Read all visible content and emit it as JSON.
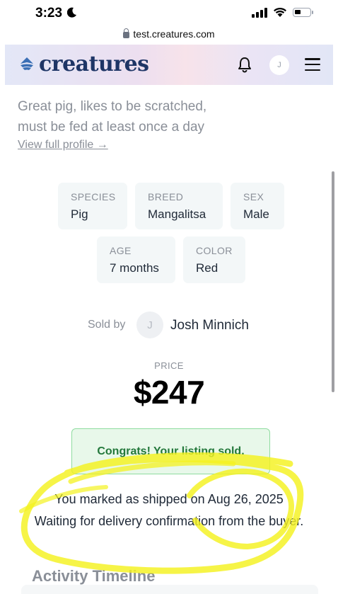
{
  "status_bar": {
    "time": "3:23"
  },
  "browser": {
    "url": "test.creatures.com"
  },
  "header": {
    "brand": "creatures",
    "avatar_initial": "J"
  },
  "listing": {
    "description_line1": "Great pig, likes to be scratched,",
    "description_line2": "must be fed at least once a day",
    "profile_link": "View full profile →",
    "attributes": [
      {
        "label": "SPECIES",
        "value": "Pig"
      },
      {
        "label": "BREED",
        "value": "Mangalitsa"
      },
      {
        "label": "SEX",
        "value": "Male"
      },
      {
        "label": "AGE",
        "value": "7 months"
      },
      {
        "label": "COLOR",
        "value": "Red"
      }
    ],
    "sold_by_label": "Sold by",
    "seller_initial": "J",
    "seller_name": "Josh Minnich",
    "price_label": "PRICE",
    "price": "$247",
    "sold_message": "Congrats! Your listing sold.",
    "shipped_message": "You marked as shipped on Aug 26, 2025",
    "waiting_message": "Waiting for delivery confirmation from the buyer."
  },
  "timeline": {
    "heading": "Activity Timeline"
  },
  "colors": {
    "brand_navy": "#1e3566",
    "sold_green_bg": "#e8f8ea",
    "sold_green_border": "#8fdca0",
    "sold_green_text": "#23783b",
    "highlight_yellow": "#f4f21f"
  },
  "icons": [
    "moon-icon",
    "signal-icon",
    "wifi-icon",
    "battery-icon",
    "lock-icon",
    "brand-logo-icon",
    "bell-icon",
    "menu-icon"
  ]
}
